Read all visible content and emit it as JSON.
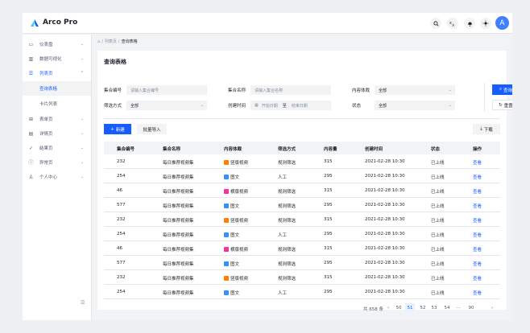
{
  "app": {
    "title": "Arco Pro"
  },
  "header": {
    "avatar_letter": "A",
    "icons": [
      "search-icon",
      "language-icon",
      "notification-icon",
      "theme-icon"
    ]
  },
  "sidebar": {
    "items": [
      {
        "label": "仪表盘",
        "icon": "dashboard-icon"
      },
      {
        "label": "数据可视化",
        "icon": "chart-icon"
      },
      {
        "label": "列表页",
        "icon": "list-icon"
      },
      {
        "label": "查询表格"
      },
      {
        "label": "卡片列表"
      },
      {
        "label": "表单页",
        "icon": "form-icon"
      },
      {
        "label": "详情页",
        "icon": "file-icon"
      },
      {
        "label": "结果页",
        "icon": "check-icon"
      },
      {
        "label": "异常页",
        "icon": "exclamation-icon"
      },
      {
        "label": "个人中心",
        "icon": "user-icon"
      }
    ]
  },
  "breadcrumb": {
    "items": [
      "列表页",
      "查询表格"
    ]
  },
  "main": {
    "title": "查询表格",
    "filters": {
      "id_label": "集合编号",
      "id_placeholder": "请输入集合编号",
      "name_label": "集合名称",
      "name_placeholder": "请输入集合名称",
      "content_label": "内容体裁",
      "content_value": "全部",
      "filter_label": "筛选方式",
      "filter_value": "全部",
      "time_label": "创建时间",
      "start_placeholder": "开始日期",
      "time_sep": "至",
      "end_placeholder": "结束日期",
      "status_label": "状态",
      "status_value": "全部"
    },
    "buttons": {
      "search": "查询",
      "reset": "重置",
      "new": "新建",
      "batch_import": "批量导入",
      "download": "下载"
    },
    "table": {
      "headers": [
        "集合编号",
        "集合名称",
        "内容体裁",
        "筛选方式",
        "内容量",
        "创建时间",
        "状态",
        "操作"
      ],
      "rows": [
        {
          "id": "232",
          "name": "每日推荐视频集",
          "content": "竖版视频",
          "tag": "orange",
          "filter": "规则筛选",
          "count": "315",
          "time": "2021-02-28 10:30",
          "status": "已上线",
          "action": "查看"
        },
        {
          "id": "254",
          "name": "每日推荐视频集",
          "content": "图文",
          "tag": "blue",
          "filter": "人工",
          "count": "295",
          "time": "2021-02-28 10:30",
          "status": "已上线",
          "action": "查看"
        },
        {
          "id": "46",
          "name": "每日推荐视频集",
          "content": "横版视频",
          "tag": "pink",
          "filter": "规则筛选",
          "count": "315",
          "time": "2021-02-28 10:30",
          "status": "已上线",
          "action": "查看"
        },
        {
          "id": "577",
          "name": "每日推荐视频集",
          "content": "图文",
          "tag": "blue",
          "filter": "规则筛选",
          "count": "295",
          "time": "2021-02-28 10:30",
          "status": "已上线",
          "action": "查看"
        },
        {
          "id": "232",
          "name": "每日推荐视频集",
          "content": "竖版视频",
          "tag": "orange",
          "filter": "规则筛选",
          "count": "315",
          "time": "2021-02-28 10:30",
          "status": "已上线",
          "action": "查看"
        },
        {
          "id": "254",
          "name": "每日推荐视频集",
          "content": "图文",
          "tag": "blue",
          "filter": "人工",
          "count": "295",
          "time": "2021-02-28 10:30",
          "status": "已上线",
          "action": "查看"
        },
        {
          "id": "46",
          "name": "每日推荐视频集",
          "content": "横版视频",
          "tag": "pink",
          "filter": "规则筛选",
          "count": "315",
          "time": "2021-02-28 10:30",
          "status": "已上线",
          "action": "查看"
        },
        {
          "id": "577",
          "name": "每日推荐视频集",
          "content": "图文",
          "tag": "blue",
          "filter": "规则筛选",
          "count": "295",
          "time": "2021-02-28 10:30",
          "status": "已上线",
          "action": "查看"
        },
        {
          "id": "232",
          "name": "每日推荐视频集",
          "content": "竖版视频",
          "tag": "orange",
          "filter": "规则筛选",
          "count": "315",
          "time": "2021-02-28 10:30",
          "status": "已上线",
          "action": "查看"
        },
        {
          "id": "254",
          "name": "每日推荐视频集",
          "content": "图文",
          "tag": "blue",
          "filter": "人工",
          "count": "295",
          "time": "2021-02-28 10:30",
          "status": "已上线",
          "action": "查看"
        }
      ]
    },
    "pagination": {
      "total": "共 658 条",
      "pages": [
        "50",
        "51",
        "52",
        "53",
        "54",
        "···",
        "90"
      ],
      "current": "51"
    }
  },
  "colors": {
    "primary": "#165dff",
    "orange": "#ff7d00",
    "blue": "#3491fa",
    "pink": "#f5319d"
  }
}
